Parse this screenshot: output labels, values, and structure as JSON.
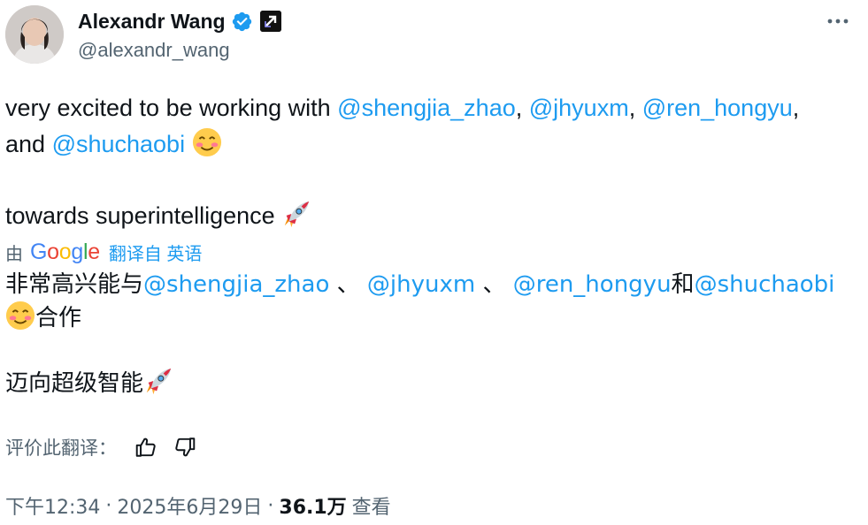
{
  "author": {
    "display_name": "Alexandr Wang",
    "handle": "@alexandr_wang",
    "verified_icon": "verified-badge-icon",
    "affiliation_icon": "org-badge-icon"
  },
  "tweet": {
    "line1_prefix": "very excited to be working with ",
    "mention1": "@shengjia_zhao",
    "sep1": ", ",
    "mention2": "@jhyuxm",
    "sep2": ", ",
    "mention3": "@ren_hongyu",
    "sep3": ",",
    "line2_prefix": "and ",
    "mention4": "@shuchaobi",
    "line3": "towards superintelligence "
  },
  "translation": {
    "by_label": "由",
    "provider": "Google",
    "source_label": "翻译自 英语",
    "line1_prefix": "非常高兴能与",
    "mention1": "@shengjia_zhao",
    "sep1": " 、 ",
    "mention2": "@jhyuxm",
    "sep2": " 、 ",
    "mention3": "@ren_hongyu",
    "join": "和",
    "mention4": "@shuchaobi",
    "line2_suffix": "合作",
    "line3": "迈向超级智能"
  },
  "rating": {
    "label": "评价此翻译："
  },
  "meta": {
    "time": "下午12:34",
    "dot1": "·",
    "date": "2025年6月29日",
    "dot2": "·",
    "views_count": "36.1万",
    "views_label": "查看"
  },
  "colors": {
    "link": "#1d9bf0",
    "text": "#0f1419",
    "muted": "#536471"
  }
}
